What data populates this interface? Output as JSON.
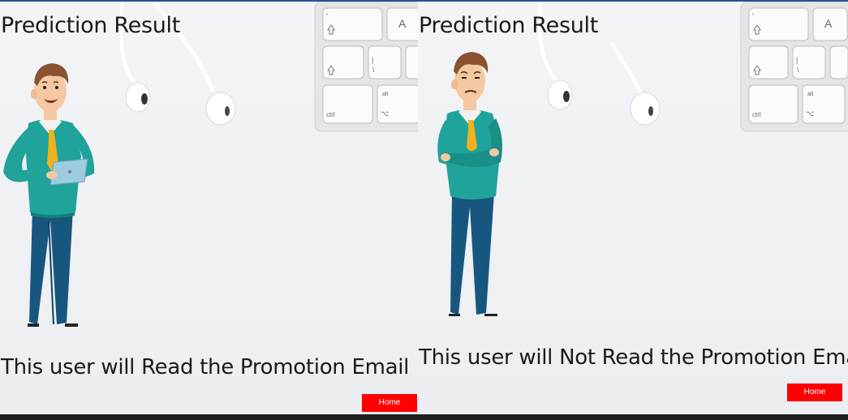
{
  "left_panel": {
    "title": "Prediction Result",
    "message": "This user will Read the Promotion Email",
    "home_button": "Home"
  },
  "right_panel": {
    "title": "Prediction Result",
    "message": "This user will Not Read the Promotion Email",
    "home_button": "Home"
  },
  "keyboard_keys": {
    "a_key": "A",
    "ctrl_key": "ctrl",
    "alt_key": "alt"
  },
  "colors": {
    "button": "#ff0000",
    "shirt": "#1fa39a",
    "pants": "#17567e",
    "tie": "#f2b21c"
  }
}
